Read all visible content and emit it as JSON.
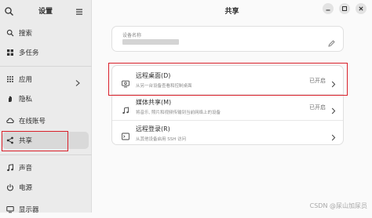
{
  "sidebar": {
    "title": "设置",
    "items": [
      {
        "label": "搜索",
        "icon": "search-icon"
      },
      {
        "label": "多任务",
        "icon": "multitask-icon"
      },
      {
        "label": "应用",
        "icon": "apps-icon"
      },
      {
        "label": "隐私",
        "icon": "privacy-hand-icon"
      },
      {
        "label": "在线账号",
        "icon": "online-accounts-icon"
      },
      {
        "label": "共享",
        "icon": "share-icon"
      },
      {
        "label": "声音",
        "icon": "music-note-icon"
      },
      {
        "label": "电源",
        "icon": "power-icon"
      },
      {
        "label": "显示器",
        "icon": "display-icon"
      }
    ]
  },
  "main": {
    "title": "共享",
    "device_name_caption": "设备名称",
    "rows": [
      {
        "title": "远程桌面(D)",
        "subtitle": "从另一台设备查看和控制桌面",
        "status": "已开启"
      },
      {
        "title": "媒体共享(M)",
        "subtitle": "将音乐, 照片和视频传输到当前网络上的设备",
        "status": "已开启"
      },
      {
        "title": "远程登录(R)",
        "subtitle": "从其他设备启用 SSH 访问",
        "status": ""
      }
    ]
  },
  "watermark": "CSDN @尿山加尿员",
  "colors": {
    "highlight_box": "#d9202a",
    "sidebar_bg": "#ebebeb",
    "main_bg": "#fafafa"
  }
}
